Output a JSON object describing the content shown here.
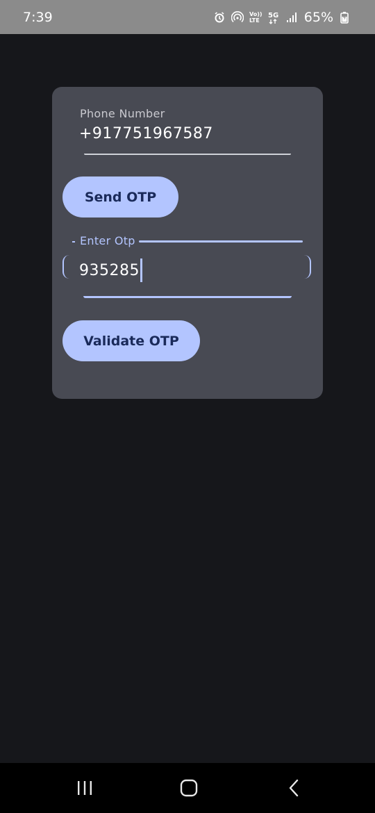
{
  "status_bar": {
    "time": "7:39",
    "battery_percent": "65%",
    "icons": [
      "alarm-icon",
      "hotspot-icon",
      "volte-icon",
      "5g-icon",
      "signal-icon",
      "battery-icon"
    ],
    "volte_text": "Vo)) LTE",
    "network_text": "5G"
  },
  "form": {
    "phone_label": "Phone Number",
    "phone_value": "+917751967587",
    "send_button_label": "Send OTP",
    "otp_label": "Enter Otp",
    "otp_value": "935285",
    "validate_button_label": "Validate OTP"
  },
  "nav_bar": {
    "icons": [
      "recents-icon",
      "home-icon",
      "back-icon"
    ]
  },
  "colors": {
    "background": "#16171b",
    "card": "#484a53",
    "accent": "#b3c5ff",
    "button_text": "#1a2a5a",
    "status_bar": "#8b8b8b"
  }
}
